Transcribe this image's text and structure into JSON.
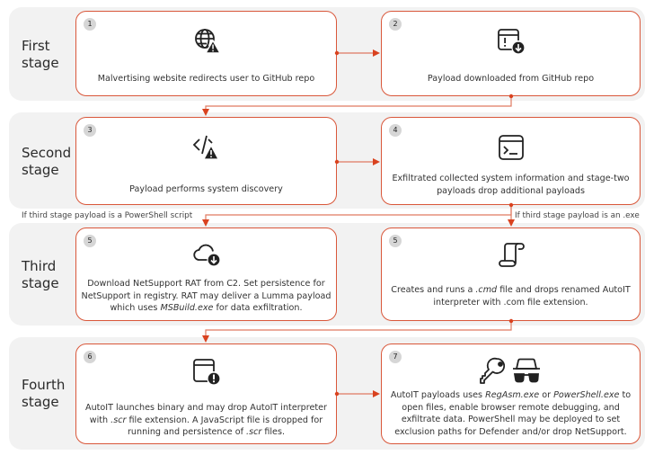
{
  "colors": {
    "accent": "#d9573a",
    "row_bg": "#f2f2f2",
    "badge_bg": "#d6d6d6"
  },
  "stages": [
    {
      "label_line1": "First",
      "label_line2": "stage"
    },
    {
      "label_line1": "Second",
      "label_line2": "stage"
    },
    {
      "label_line1": "Third",
      "label_line2": "stage"
    },
    {
      "label_line1": "Fourth",
      "label_line2": "stage"
    }
  ],
  "steps": [
    {
      "number": "1",
      "icon": "globe-warning-icon",
      "text": "Malvertising website redirects user to GitHub repo"
    },
    {
      "number": "2",
      "icon": "window-download-icon",
      "text": "Payload downloaded from GitHub repo"
    },
    {
      "number": "3",
      "icon": "code-warning-icon",
      "text": "Payload performs system discovery"
    },
    {
      "number": "4",
      "icon": "terminal-icon",
      "text": "Exfiltrated collected system information and stage-two payloads drop additional payloads"
    },
    {
      "number": "5",
      "icon": "cloud-download-icon",
      "text_parts": [
        "Download NetSupport RAT from C2. Set persistence for NetSupport in registry. RAT may deliver a Lumma payload which uses ",
        "MSBuild.exe",
        " for data exfiltration."
      ]
    },
    {
      "number": "5",
      "icon": "script-scroll-icon",
      "text_parts": [
        "Creates and runs a ",
        ".cmd",
        " file and drops renamed AutoIT interpreter with .com file extension."
      ]
    },
    {
      "number": "6",
      "icon": "window-alert-icon",
      "text_parts": [
        "AutoIT launches binary and may drop AutoIT interpreter with ",
        ".scr",
        " file extension. A JavaScript file is dropped for running and persistence of ",
        ".scr",
        " files."
      ]
    },
    {
      "number": "7",
      "icon": "key-and-incognito-icon",
      "text_parts": [
        "AutoIT payloads uses ",
        "RegAsm.exe",
        " or ",
        "PowerShell.exe",
        " to open files, enable browser remote debugging, and exfiltrate data. PowerShell may be deployed to set exclusion paths for Defender and/or drop NetSupport."
      ]
    }
  ],
  "conditions": {
    "powershell": "If third stage payload is a PowerShell script",
    "exe": "If third stage payload is an .exe"
  }
}
